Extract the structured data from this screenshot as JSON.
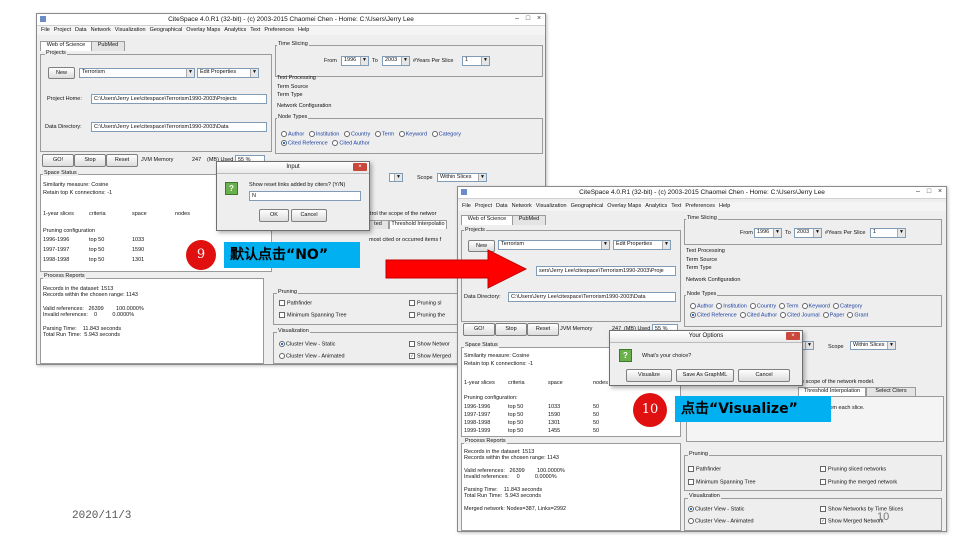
{
  "left_window": {
    "title": "CiteSpace 4.0.R1 (32-bit) - (c) 2003-2015 Chaomei Chen - Home: C:\\Users\\Jerry Lee",
    "menu": [
      "File",
      "Project",
      "Data",
      "Network",
      "Visualization",
      "Geographical",
      "Overlay Maps",
      "Analytics",
      "Text",
      "Preferences",
      "Help"
    ],
    "tabs": [
      "Web of Science",
      "PubMed"
    ],
    "projects_label": "Projects",
    "new_button": "New",
    "project_name": "Terrorism",
    "edit_properties": "Edit Properties",
    "project_home_label": "Project Home:",
    "project_home_value": "C:\\Users\\Jerry Lee\\citespace\\Terrorism1990-2003\\Projects",
    "data_directory_label": "Data Directory:",
    "data_directory_value": "C:\\Users\\Jerry Lee\\citespace\\Terrorism1990-2003\\Data",
    "buttons": [
      "GO!",
      "Stop",
      "Reset"
    ],
    "jvm_label": "JVM Memory",
    "jvm_value": "247",
    "mb_used": "(MB) Used",
    "percent": "55 %",
    "time_slicing": "Time Slicing",
    "from_label": "From",
    "from_value": "1996",
    "to_label": "To",
    "to_value": "2003",
    "years_per_slice_label": "#Years Per Slice",
    "years_per_slice_value": "1",
    "text_processing": "Text Processing",
    "term_source": "Term Source",
    "term_type": "Term Type",
    "network_configuration": "Network Configuration",
    "node_types": "Node Types",
    "node_row1": [
      "Author",
      "Institution",
      "Country",
      "Term",
      "Keyword",
      "Category"
    ],
    "node_row2": [
      "Cited Reference",
      "Cited Author"
    ],
    "space_status": "Space Status",
    "space_lines": [
      "Similarity measure: Cosine",
      "Retain top K connections: -1"
    ],
    "table_header": [
      "1-year slices",
      "criteria",
      "space",
      "nodes"
    ],
    "pruning_config": "Pruning configuration",
    "table_rows": [
      [
        "1996-1996",
        "top 50",
        "1033"
      ],
      [
        "1997-1997",
        "top 50",
        "1590"
      ],
      [
        "1998-1998",
        "top 50",
        "1301"
      ]
    ],
    "scope_label": "Scope",
    "scope_value": "Within Slices",
    "control_scope": "ntrol the scope of the networ",
    "interp_tab": "Threshold Interpolatio",
    "selected_label": "ted",
    "cited_items": "most cited or occurred items f",
    "process_reports": "Process Reports",
    "report_lines": [
      "Records in the dataset: 1513",
      "Records within the chosen range: 1143",
      "",
      "Valid references:   26399        100.0000%",
      "Invalid references:    0          0.0000%",
      "",
      "Parsing Time:    11.843 seconds",
      "Total Run Time:  5.943 seconds"
    ],
    "pruning": "Pruning",
    "pathfinder": "Pathfinder",
    "min_spanning_tree": "Minimum Spanning Tree",
    "pruning_sliced": "Pruning sl",
    "pruning_the": "Pruning the",
    "visualization": "Visualization",
    "cv_static": "Cluster View - Static",
    "cv_animated": "Cluster View - Animated",
    "show_network": "Show Networ",
    "show_merged": "Show Merged"
  },
  "input_dialog": {
    "title": "Input",
    "question": "Show reset links added by citers? (Y/N)",
    "value": "N",
    "ok": "OK",
    "cancel": "Cancel"
  },
  "callout9": {
    "number": "9",
    "text": "默认点击“NO”"
  },
  "callout10": {
    "number": "10",
    "text": "点击“Visualize”"
  },
  "right_window": {
    "title": "CiteSpace 4.0.R1 (32-bit) - (c) 2003-2015 Chaomei Chen - Home: C:\\Users\\Jerry Lee",
    "menu": [
      "File",
      "Project",
      "Data",
      "Network",
      "Visualization",
      "Geographical",
      "Overlay Maps",
      "Analytics",
      "Text",
      "Preferences",
      "Help"
    ],
    "tabs": [
      "Web of Science",
      "PubMed"
    ],
    "projects_label": "Projects",
    "new_button": "New",
    "project_name": "Terrorism",
    "edit_properties": "Edit Properties",
    "project_home_value": "sers\\Jerry Lee\\citespace\\Terrorism1990-2003\\Proje",
    "data_directory_label": "Data Directory:",
    "data_directory_value": "C:\\Users\\Jerry Lee\\citespace\\Terrorism1990-2003\\Data",
    "buttons": [
      "GO!",
      "Stop",
      "Reset"
    ],
    "jvm_label": "JVM Memory",
    "jvm_value": "247",
    "mb_used": "(MB) Used",
    "percent": "55 %",
    "time_slicing": "Time Slicing",
    "from_label": "From",
    "from_value": "1996",
    "to_label": "To",
    "to_value": "2003",
    "years_per_slice_label": "#Years Per Slice",
    "years_per_slice_value": "1",
    "text_processing": "Text Processing",
    "term_source": "Term Source",
    "term_type": "Term Type",
    "network_configuration": "Network Configuration",
    "node_types": "Node Types",
    "node_row1": [
      "Author",
      "Institution",
      "Country",
      "Term",
      "Keyword",
      "Category"
    ],
    "node_row2": [
      "Cited Reference",
      "Cited Author",
      "Cited Journal",
      "Paper",
      "Grant"
    ],
    "space_status": "Space Status",
    "space_lines": [
      "Similarity measure: Cosine",
      "Retain top K connections: -1"
    ],
    "table_header": [
      "1-year slices",
      "criteria",
      "space",
      "nodes"
    ],
    "pruning_config": "Pruning configuration:",
    "table_rows": [
      [
        "1996-1996",
        "top 50",
        "1033",
        "50"
      ],
      [
        "1997-1997",
        "top 50",
        "1590",
        "50"
      ],
      [
        "1998-1998",
        "top 50",
        "1301",
        "50"
      ],
      [
        "1999-1999",
        "top 50",
        "1455",
        "50"
      ]
    ],
    "scope_label": "Scope",
    "scope_value": "Within Slices",
    "control_scope": "he scope of the network model.",
    "tabs2": [
      "Threshold Interpolation",
      "Select Citers"
    ],
    "cited_items": "rred items from each slice.",
    "process_reports": "Process Reports",
    "report_lines": [
      "Records in the dataset: 1513",
      "Records within the chosen range: 1143",
      "",
      "Valid references:   26399        100.0000%",
      "Invalid references:     0          0.0000%",
      "",
      "Parsing Time:    11.843 seconds",
      "Total Run Time:  5.943 seconds",
      "",
      "Merged network: Nodes=387, Links=2992"
    ],
    "pruning": "Pruning",
    "pathfinder": "Pathfinder",
    "min_spanning_tree": "Minimum Spanning Tree",
    "pruning_sliced": "Pruning sliced networks",
    "pruning_merged": "Pruning the merged network",
    "visualization": "Visualization",
    "cv_static": "Cluster View - Static",
    "cv_animated": "Cluster View - Animated",
    "show_networks_time": "Show Networks by Time Slices",
    "show_merged": "Show Merged Network"
  },
  "options_dialog": {
    "title": "Your Options",
    "question": "What's your choice?",
    "buttons": [
      "Visualize",
      "Save As GraphML",
      "Cancel"
    ]
  },
  "footer": {
    "date": "2020/11/3",
    "page": "10"
  },
  "colors": {
    "callout_bg": "#00b0f0",
    "circle_red": "#e01010",
    "arrow_red": "#ff0000"
  }
}
